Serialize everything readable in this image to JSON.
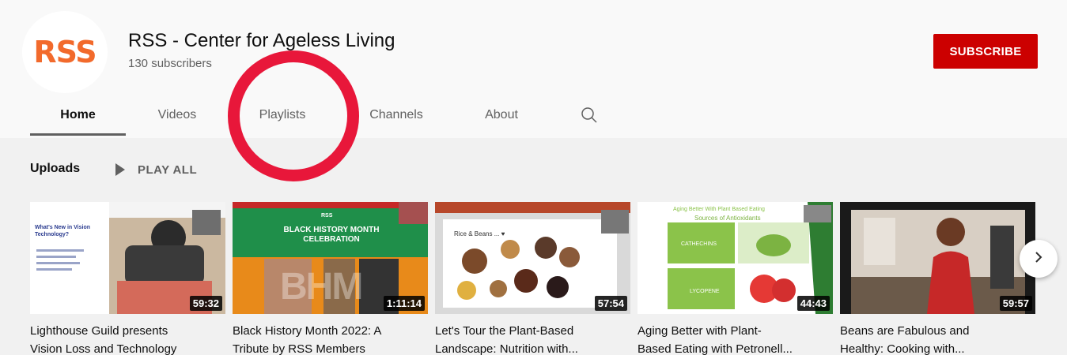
{
  "channel": {
    "avatar_text": "RSS",
    "name": "RSS - Center for Ageless Living",
    "subscribers": "130 subscribers",
    "subscribe_label": "SUBSCRIBE"
  },
  "tabs": [
    {
      "label": "Home",
      "active": true
    },
    {
      "label": "Videos",
      "active": false
    },
    {
      "label": "Playlists",
      "active": false
    },
    {
      "label": "Channels",
      "active": false
    },
    {
      "label": "About",
      "active": false
    }
  ],
  "uploads": {
    "title": "Uploads",
    "play_all": "PLAY ALL"
  },
  "videos": [
    {
      "thumb_title": "What's New in Vision Technology?",
      "duration": "59:32",
      "title_line1": "Lighthouse Guild presents",
      "title_line2": "Vision Loss and Technology"
    },
    {
      "thumb_title": "BLACK HISTORY MONTH CELEBRATION",
      "thumb_tag": "RSS",
      "thumb_big": "BHM",
      "duration": "1:11:14",
      "title_line1": "Black History Month 2022: A",
      "title_line2": "Tribute by RSS Members"
    },
    {
      "thumb_title": "Rice & Beans ... ♥",
      "duration": "57:54",
      "title_line1": "Let's Tour the Plant-Based",
      "title_line2": "Landscape: Nutrition with..."
    },
    {
      "thumb_title": "Aging Better With Plant Based Eating",
      "thumb_subtitle": "Sources of Antioxidants",
      "thumb_label1": "CATHECHINS",
      "thumb_label2": "LYCOPENE",
      "duration": "44:43",
      "title_line1": "Aging Better with Plant-",
      "title_line2": "Based Eating with Petronell..."
    },
    {
      "duration": "59:57",
      "title_line1": "Beans are Fabulous and",
      "title_line2": "Healthy: Cooking with..."
    }
  ],
  "icons": {
    "search": "search-icon",
    "next": "chevron-right-icon",
    "play": "play-icon"
  },
  "colors": {
    "subscribe": "#cc0000",
    "avatar_text": "#f26a2c",
    "annotation_circle": "#e8173a"
  }
}
